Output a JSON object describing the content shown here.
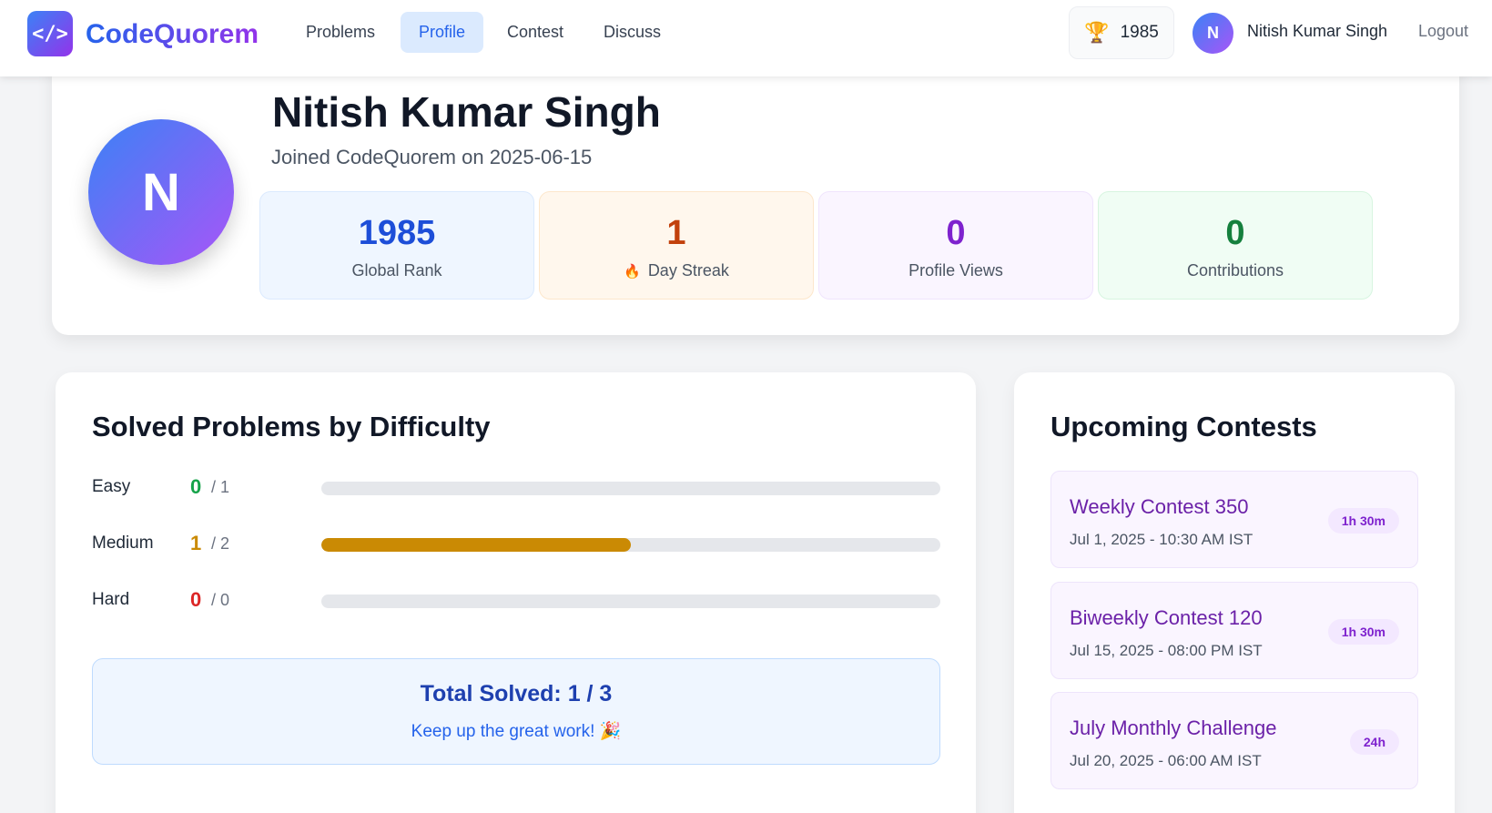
{
  "nav": {
    "logo_symbol": "</>",
    "brand": "CodeQuorem",
    "links": [
      "Problems",
      "Profile",
      "Contest",
      "Discuss"
    ],
    "active_link": "Profile",
    "rating": "1985",
    "rating_icon": "trophy-icon",
    "avatar_initial": "N",
    "username": "Nitish Kumar Singh",
    "logout": "Logout"
  },
  "profile": {
    "avatar_initial": "N",
    "name": "Nitish Kumar Singh",
    "joined": "Joined CodeQuorem on 2025-06-15",
    "stats": [
      {
        "value": "1985",
        "label": "Global Rank",
        "icon": "",
        "color": "#1d4ed8",
        "bg": "#eff6ff",
        "border": "#dbeafe"
      },
      {
        "value": "1",
        "label": "Day Streak",
        "icon": "🔥",
        "color": "#c2410c",
        "bg": "#fff7ed",
        "border": "#fde7cc"
      },
      {
        "value": "0",
        "label": "Profile Views",
        "icon": "",
        "color": "#7e22ce",
        "bg": "#faf5ff",
        "border": "#f0e4fd"
      },
      {
        "value": "0",
        "label": "Contributions",
        "icon": "",
        "color": "#15803d",
        "bg": "#f0fdf4",
        "border": "#d7f5e0"
      }
    ]
  },
  "solved": {
    "title": "Solved Problems by Difficulty",
    "rows": [
      {
        "name": "Easy",
        "solved": "0",
        "total": "/ 1",
        "progress": 0,
        "color": "#16a34a"
      },
      {
        "name": "Medium",
        "solved": "1",
        "total": "/ 2",
        "progress": 0.5,
        "color": "#ca8a04"
      },
      {
        "name": "Hard",
        "solved": "0",
        "total": "/ 0",
        "progress": 0,
        "color": "#dc2626"
      }
    ],
    "total_title": "Total Solved: 1 / 3",
    "total_msg": "Keep up the great work! 🎉"
  },
  "contests": {
    "title": "Upcoming Contests",
    "items": [
      {
        "name": "Weekly Contest 350",
        "date": "Jul 1, 2025 - 10:30 AM IST",
        "duration": "1h 30m"
      },
      {
        "name": "Biweekly Contest 120",
        "date": "Jul 15, 2025 - 08:00 PM IST",
        "duration": "1h 30m"
      },
      {
        "name": "July Monthly Challenge",
        "date": "Jul 20, 2025 - 06:00 AM IST",
        "duration": "24h"
      }
    ]
  }
}
